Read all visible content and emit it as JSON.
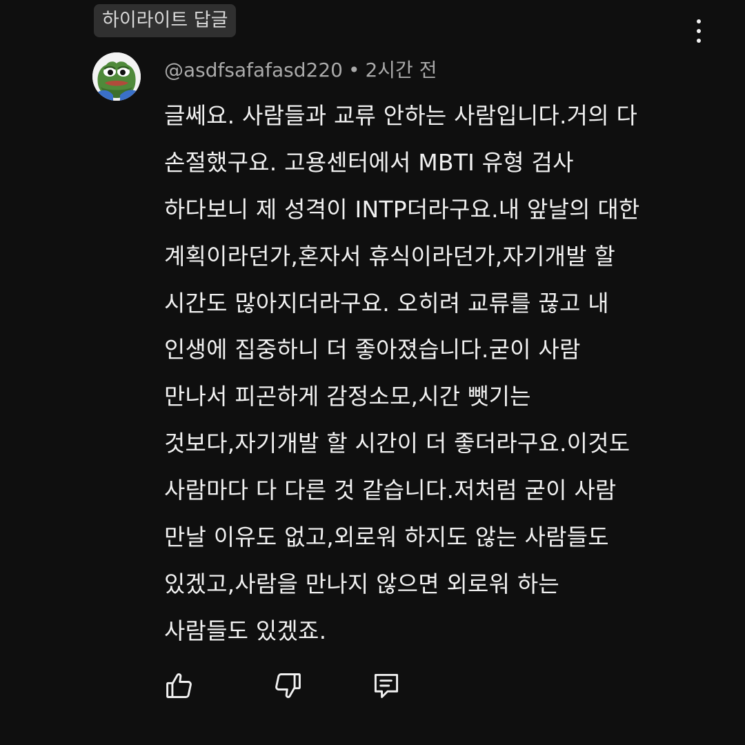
{
  "header": {
    "badge_label": "하이라이트 답글",
    "more_icon": "more-vert-icon"
  },
  "comment": {
    "author": "@asdfsafafasd220",
    "separator": "•",
    "timestamp": "2시간 전",
    "avatar_icon": "frog-avatar",
    "lines": [
      "글쎄요. 사람들과 교류 안하는 사람입니다.거의 다",
      "손절했구요. 고용센터에서 MBTI 유형 검사",
      "하다보니 제 성격이 INTP더라구요.내 앞날의 대한",
      "계획이라던가,혼자서 휴식이라던가,자기개발 할",
      "시간도 많아지더라구요. 오히려 교류를 끊고 내",
      "인생에 집중하니 더 좋아졌습니다.굳이 사람",
      "만나서 피곤하게 감정소모,시간 뺏기는",
      "것보다,자기개발 할 시간이 더 좋더라구요.이것도",
      "사람마다 다 다른 것 같습니다.저처럼 굳이 사람",
      "만날 이유도 없고,외로워 하지도 않는 사람들도",
      "있겠고,사람을 만나지 않으면 외로워 하는",
      "사람들도 있겠죠."
    ]
  },
  "actions": {
    "like_icon": "thumbs-up-icon",
    "dislike_icon": "thumbs-down-icon",
    "reply_icon": "reply-comment-icon"
  },
  "colors": {
    "background": "#0f0f0f",
    "text": "#f1f1f1",
    "muted": "#aaaaaa",
    "badge_bg": "#303030"
  }
}
